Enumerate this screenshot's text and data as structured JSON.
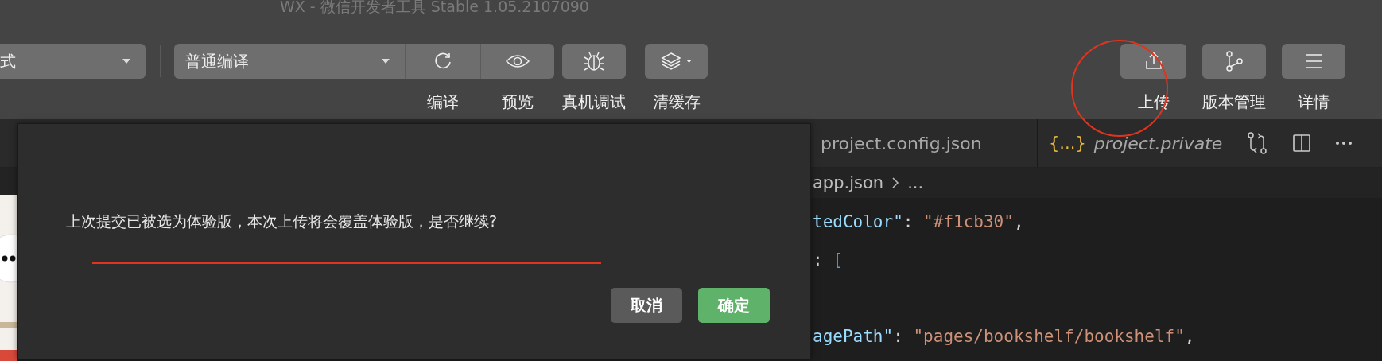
{
  "window": {
    "title": "WX - 微信开发者工具 Stable 1.05.2107090"
  },
  "toolbar": {
    "mode_select": {
      "value": "式"
    },
    "compile_select": {
      "value": "普通编译"
    },
    "left_buttons": [
      {
        "kind": "refresh",
        "label": "编译"
      },
      {
        "kind": "eye",
        "label": "预览"
      },
      {
        "kind": "bug",
        "label": "真机调试"
      },
      {
        "kind": "layers",
        "label": "清缓存"
      }
    ],
    "right_buttons": [
      {
        "kind": "upload",
        "label": "上传"
      },
      {
        "kind": "branch",
        "label": "版本管理"
      },
      {
        "kind": "menu",
        "label": "详情"
      }
    ]
  },
  "editor": {
    "tabs": [
      {
        "label": "project.config.json",
        "italic": false
      },
      {
        "icon_text": "{...}",
        "label": "project.private",
        "italic": true
      }
    ],
    "breadcrumb": [
      "app.json",
      "..."
    ],
    "code_lines": [
      {
        "tokens": [
          {
            "kind": "key",
            "text": "tedColor\""
          },
          {
            "kind": "punct",
            "text": ": "
          },
          {
            "kind": "string",
            "text": "\"#f1cb30\""
          },
          {
            "kind": "punct",
            "text": ","
          }
        ]
      },
      {
        "tokens": [
          {
            "kind": "punct",
            "text": ": "
          },
          {
            "kind": "bracket",
            "text": "["
          }
        ]
      },
      {
        "kind": "blank"
      },
      {
        "tokens": [
          {
            "kind": "key",
            "text": "agePath\""
          },
          {
            "kind": "punct",
            "text": ": "
          },
          {
            "kind": "string",
            "text": "\"pages/bookshelf/bookshelf\""
          },
          {
            "kind": "punct",
            "text": ","
          }
        ]
      }
    ]
  },
  "dialog": {
    "message": "上次提交已被选为体验版，本次上传将会覆盖体验版，是否继续?",
    "buttons": [
      {
        "kind": "secondary",
        "label": "取消"
      },
      {
        "kind": "primary",
        "label": "确定"
      }
    ]
  }
}
